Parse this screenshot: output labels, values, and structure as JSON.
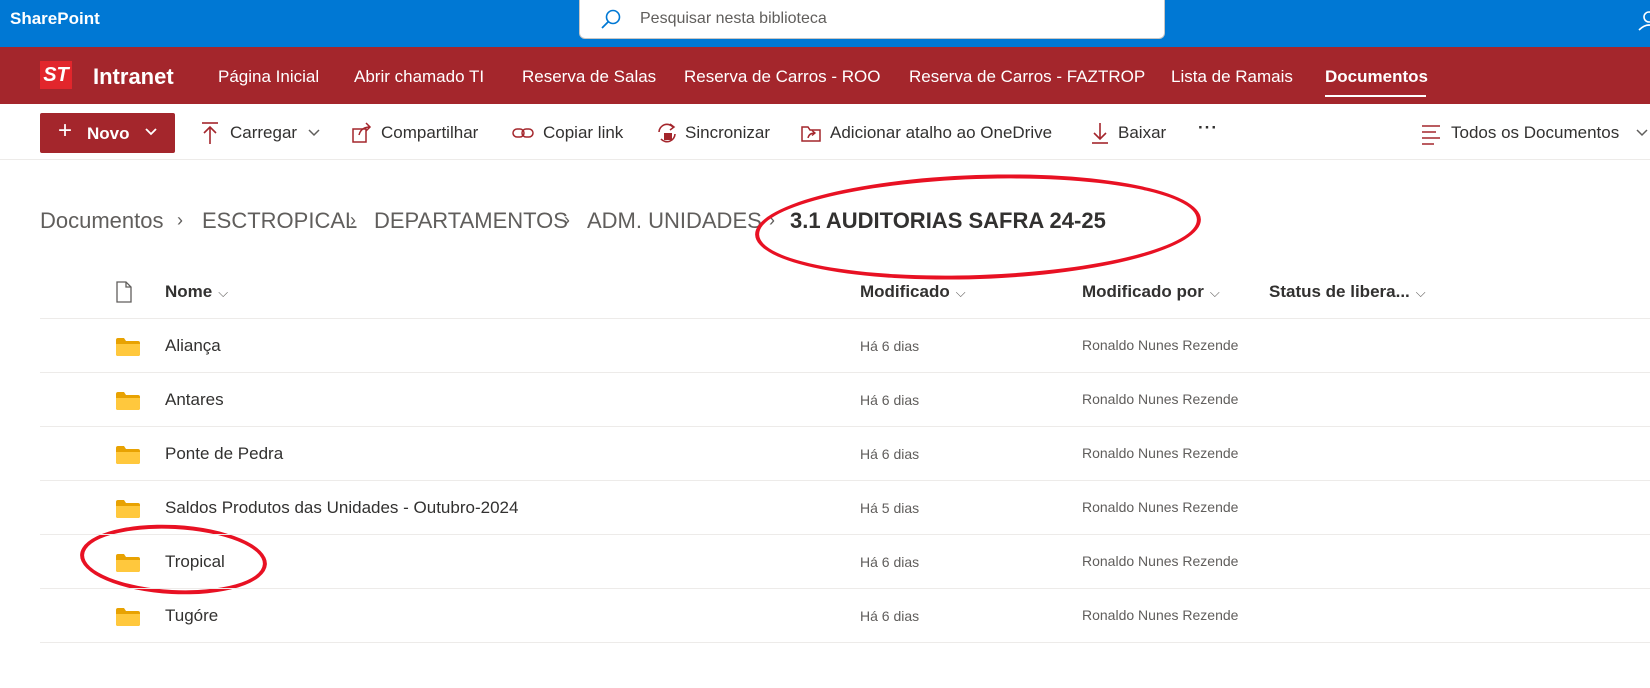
{
  "suite": {
    "brand": "SharePoint",
    "search_placeholder": "Pesquisar nesta biblioteca"
  },
  "site": {
    "logo_text": "ST",
    "name": "Intranet",
    "nav": [
      {
        "label": "Página Inicial"
      },
      {
        "label": "Abrir chamado TI"
      },
      {
        "label": "Reserva de Salas"
      },
      {
        "label": "Reserva de Carros - ROO"
      },
      {
        "label": "Reserva de Carros - FAZTROP"
      },
      {
        "label": "Lista de Ramais"
      },
      {
        "label": "Documentos",
        "active": true
      }
    ]
  },
  "commands": {
    "new_label": "Novo",
    "upload": "Carregar",
    "share": "Compartilhar",
    "copy_link": "Copiar link",
    "sync": "Sincronizar",
    "add_shortcut": "Adicionar atalho ao OneDrive",
    "download": "Baixar",
    "more": "···",
    "view": "Todos os Documentos"
  },
  "breadcrumb": [
    "Documentos",
    "ESCTROPICAL",
    "DEPARTAMENTOS",
    "ADM. UNIDADES",
    "3.1 AUDITORIAS SAFRA 24-25"
  ],
  "columns": {
    "name": "Nome",
    "modified": "Modificado",
    "modified_by": "Modificado por",
    "status": "Status de libera..."
  },
  "rows": [
    {
      "name": "Aliança",
      "modified": "Há 6 dias",
      "modified_by": "Ronaldo Nunes Rezende"
    },
    {
      "name": "Antares",
      "modified": "Há 6 dias",
      "modified_by": "Ronaldo Nunes Rezende"
    },
    {
      "name": "Ponte de Pedra",
      "modified": "Há 6 dias",
      "modified_by": "Ronaldo Nunes Rezende"
    },
    {
      "name": "Saldos Produtos das Unidades - Outubro-2024",
      "modified": "Há 5 dias",
      "modified_by": "Ronaldo Nunes Rezende"
    },
    {
      "name": "Tropical",
      "modified": "Há 6 dias",
      "modified_by": "Ronaldo Nunes Rezende"
    },
    {
      "name": "Tugóre",
      "modified": "Há 6 dias",
      "modified_by": "Ronaldo Nunes Rezende"
    }
  ],
  "colors": {
    "suite_blue": "#0078d4",
    "brand_red": "#a4262c",
    "annotation_red": "#e81123",
    "folder_yellow": "#ffb900"
  }
}
